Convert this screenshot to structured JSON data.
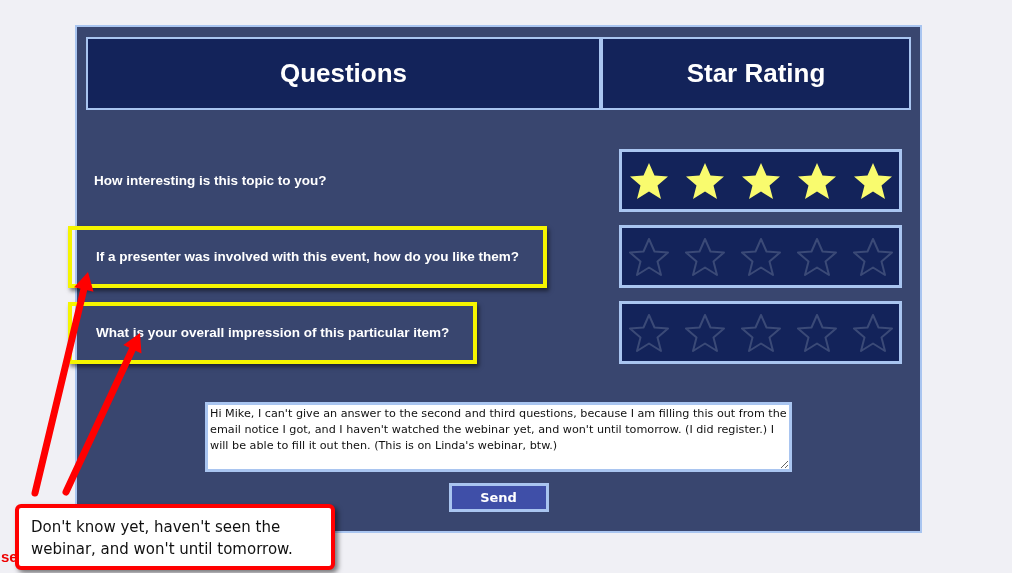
{
  "table": {
    "columns": [
      "Questions",
      "Star Rating"
    ],
    "rows": [
      {
        "question": "How interesting is this topic to you?",
        "stars": 5,
        "highlighted": false
      },
      {
        "question": "If a presenter was involved with this event, how do you like them?",
        "stars": 0,
        "highlighted": true
      },
      {
        "question": "What is your overall impression of this particular item?",
        "stars": 0,
        "highlighted": true
      }
    ]
  },
  "comment": {
    "value": "Hi Mike, I can't give an answer to the second and third questions, because I am filling this out from the email notice I got, and I haven't watched the webinar yet, and won't until tomorrow. (I did register.) I will be able to fill it out then. (This is on Linda's webinar, btw.)"
  },
  "buttons": [
    "Send"
  ],
  "stray_text": "se",
  "callout": {
    "text": "Don't know yet, haven't seen the webinar, and won't until tomorrow."
  }
}
